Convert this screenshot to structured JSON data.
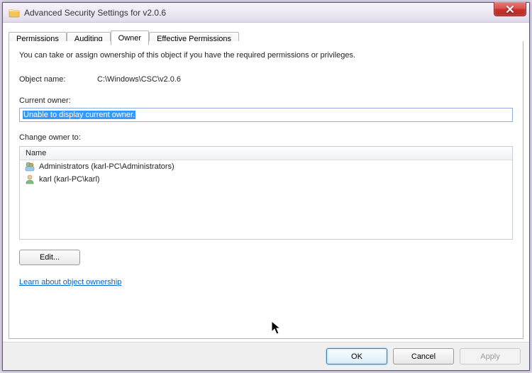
{
  "window": {
    "title": "Advanced Security Settings for v2.0.6",
    "close_glyph": "X"
  },
  "tabs": {
    "permissions": "Permissions",
    "auditing": "Auditing",
    "owner": "Owner",
    "effective": "Effective Permissions"
  },
  "panel": {
    "intro": "You can take or assign ownership of this object if you have the required permissions or privileges.",
    "object_name_label": "Object name:",
    "object_name_value": "C:\\Windows\\CSC\\v2.0.6",
    "current_owner_label": "Current owner:",
    "current_owner_value": "Unable to display current owner.",
    "change_owner_label": "Change owner to:",
    "list_header": "Name",
    "owners": [
      {
        "label": "Administrators (karl-PC\\Administrators)",
        "icon": "group"
      },
      {
        "label": "karl (karl-PC\\karl)",
        "icon": "user"
      }
    ],
    "edit_label": "Edit...",
    "learn_link": "Learn about object ownership"
  },
  "footer": {
    "ok": "OK",
    "cancel": "Cancel",
    "apply": "Apply"
  }
}
